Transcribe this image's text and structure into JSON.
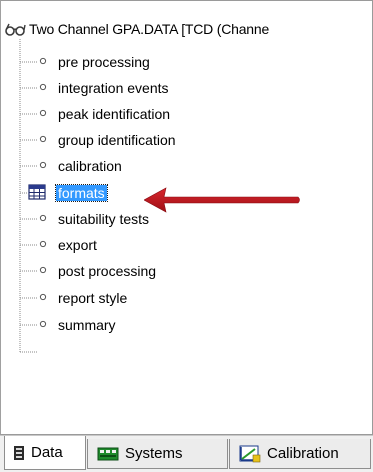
{
  "tree": {
    "root_label": "Two Channel GPA.DATA [TCD  (Channe",
    "root_icon": "glasses-icon",
    "items": [
      {
        "label": "pre processing",
        "icon": "bullet-dot-icon"
      },
      {
        "label": "integration events",
        "icon": "bullet-dot-icon"
      },
      {
        "label": "peak identification",
        "icon": "bullet-dot-icon"
      },
      {
        "label": "group identification",
        "icon": "bullet-dot-icon"
      },
      {
        "label": "calibration",
        "icon": "bullet-dot-icon"
      },
      {
        "label": "formats",
        "icon": "table-grid-icon",
        "selected": true
      },
      {
        "label": "suitability tests",
        "icon": "bullet-dot-icon"
      },
      {
        "label": "export",
        "icon": "bullet-dot-icon"
      },
      {
        "label": "post processing",
        "icon": "bullet-dot-icon"
      },
      {
        "label": "report style",
        "icon": "bullet-dot-icon"
      },
      {
        "label": "summary",
        "icon": "bullet-dot-icon"
      }
    ],
    "selected_color": "#3399ff"
  },
  "annotation": {
    "arrow_color": "#c0141c",
    "icon": "red-arrow-icon"
  },
  "tabs": [
    {
      "label": "Data",
      "icon": "data-bin-icon",
      "active": true
    },
    {
      "label": "Systems",
      "icon": "systems-board-icon",
      "active": false
    },
    {
      "label": "Calibration",
      "icon": "calibration-chart-icon",
      "active": false
    }
  ]
}
